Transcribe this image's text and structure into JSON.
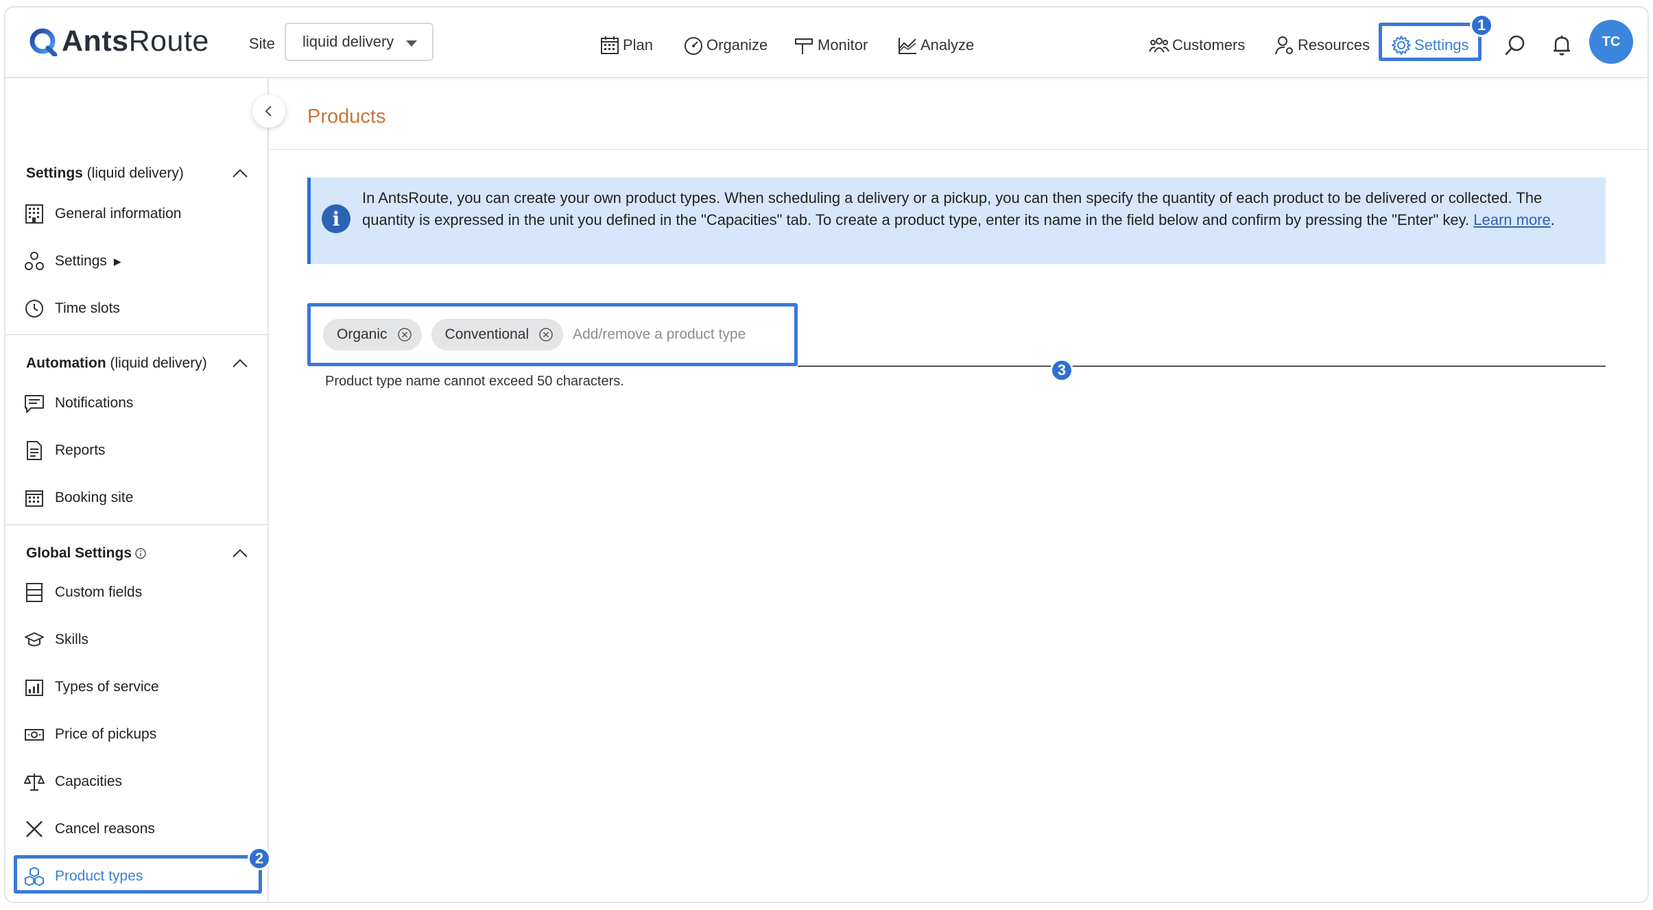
{
  "app": {
    "logo_bold": "Ants",
    "logo_light": "Route"
  },
  "header": {
    "site_label": "Site",
    "site_value": "liquid delivery",
    "nav": {
      "plan": "Plan",
      "organize": "Organize",
      "monitor": "Monitor",
      "analyze": "Analyze",
      "customers": "Customers",
      "resources": "Resources",
      "settings": "Settings"
    },
    "avatar_initials": "TC",
    "accent_color": "#3b7fd6"
  },
  "badges": {
    "one": "1",
    "two": "2",
    "three": "3"
  },
  "sidebar": {
    "section_settings": {
      "bold": "Settings",
      "rest": " (liquid delivery)"
    },
    "section_automation": {
      "bold": "Automation",
      "rest": " (liquid delivery)"
    },
    "section_global": {
      "bold": "Global Settings"
    },
    "items": {
      "general_information": "General information",
      "settings": "Settings",
      "settings_arrow": "▶",
      "time_slots": "Time slots",
      "notifications": "Notifications",
      "reports": "Reports",
      "booking_site": "Booking site",
      "custom_fields": "Custom fields",
      "skills": "Skills",
      "types_of_service": "Types of service",
      "price_of_pickups": "Price of pickups",
      "capacities": "Capacities",
      "cancel_reasons": "Cancel reasons",
      "product_types": "Product types"
    }
  },
  "main": {
    "title": "Products",
    "info_text": "In AntsRoute, you can create your own product types. When scheduling a delivery or a pickup, you can then specify the quantity of each product to be delivered or collected. The quantity is expressed in the unit you defined in the \"Capacities\" tab. To create a product type, enter its name in the field below and confirm by pressing the \"Enter\" key. ",
    "learn_more": "Learn more",
    "info_end": ".",
    "tags": [
      "Organic",
      "Conventional"
    ],
    "input_placeholder": "Add/remove a product type",
    "hint": "Product type name cannot exceed 50 characters."
  }
}
